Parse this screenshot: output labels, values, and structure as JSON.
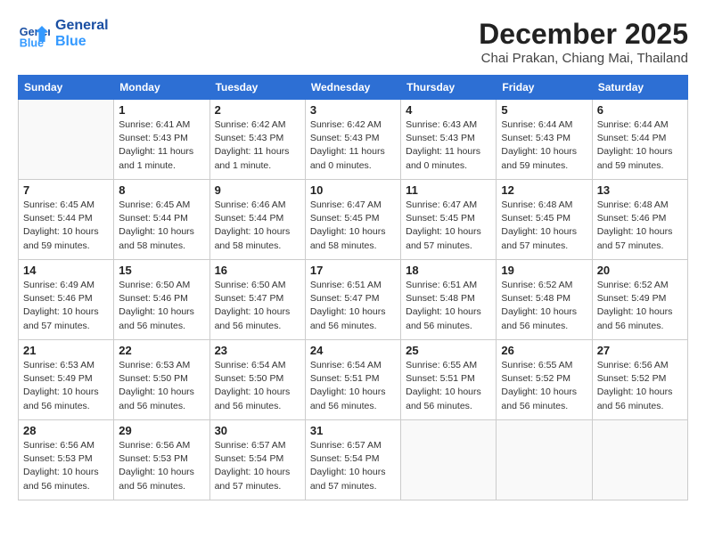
{
  "header": {
    "logo_line1": "General",
    "logo_line2": "Blue",
    "month": "December 2025",
    "location": "Chai Prakan, Chiang Mai, Thailand"
  },
  "weekdays": [
    "Sunday",
    "Monday",
    "Tuesday",
    "Wednesday",
    "Thursday",
    "Friday",
    "Saturday"
  ],
  "weeks": [
    [
      {
        "day": "",
        "info": ""
      },
      {
        "day": "1",
        "info": "Sunrise: 6:41 AM\nSunset: 5:43 PM\nDaylight: 11 hours\nand 1 minute."
      },
      {
        "day": "2",
        "info": "Sunrise: 6:42 AM\nSunset: 5:43 PM\nDaylight: 11 hours\nand 1 minute."
      },
      {
        "day": "3",
        "info": "Sunrise: 6:42 AM\nSunset: 5:43 PM\nDaylight: 11 hours\nand 0 minutes."
      },
      {
        "day": "4",
        "info": "Sunrise: 6:43 AM\nSunset: 5:43 PM\nDaylight: 11 hours\nand 0 minutes."
      },
      {
        "day": "5",
        "info": "Sunrise: 6:44 AM\nSunset: 5:43 PM\nDaylight: 10 hours\nand 59 minutes."
      },
      {
        "day": "6",
        "info": "Sunrise: 6:44 AM\nSunset: 5:44 PM\nDaylight: 10 hours\nand 59 minutes."
      }
    ],
    [
      {
        "day": "7",
        "info": "Sunrise: 6:45 AM\nSunset: 5:44 PM\nDaylight: 10 hours\nand 59 minutes."
      },
      {
        "day": "8",
        "info": "Sunrise: 6:45 AM\nSunset: 5:44 PM\nDaylight: 10 hours\nand 58 minutes."
      },
      {
        "day": "9",
        "info": "Sunrise: 6:46 AM\nSunset: 5:44 PM\nDaylight: 10 hours\nand 58 minutes."
      },
      {
        "day": "10",
        "info": "Sunrise: 6:47 AM\nSunset: 5:45 PM\nDaylight: 10 hours\nand 58 minutes."
      },
      {
        "day": "11",
        "info": "Sunrise: 6:47 AM\nSunset: 5:45 PM\nDaylight: 10 hours\nand 57 minutes."
      },
      {
        "day": "12",
        "info": "Sunrise: 6:48 AM\nSunset: 5:45 PM\nDaylight: 10 hours\nand 57 minutes."
      },
      {
        "day": "13",
        "info": "Sunrise: 6:48 AM\nSunset: 5:46 PM\nDaylight: 10 hours\nand 57 minutes."
      }
    ],
    [
      {
        "day": "14",
        "info": "Sunrise: 6:49 AM\nSunset: 5:46 PM\nDaylight: 10 hours\nand 57 minutes."
      },
      {
        "day": "15",
        "info": "Sunrise: 6:50 AM\nSunset: 5:46 PM\nDaylight: 10 hours\nand 56 minutes."
      },
      {
        "day": "16",
        "info": "Sunrise: 6:50 AM\nSunset: 5:47 PM\nDaylight: 10 hours\nand 56 minutes."
      },
      {
        "day": "17",
        "info": "Sunrise: 6:51 AM\nSunset: 5:47 PM\nDaylight: 10 hours\nand 56 minutes."
      },
      {
        "day": "18",
        "info": "Sunrise: 6:51 AM\nSunset: 5:48 PM\nDaylight: 10 hours\nand 56 minutes."
      },
      {
        "day": "19",
        "info": "Sunrise: 6:52 AM\nSunset: 5:48 PM\nDaylight: 10 hours\nand 56 minutes."
      },
      {
        "day": "20",
        "info": "Sunrise: 6:52 AM\nSunset: 5:49 PM\nDaylight: 10 hours\nand 56 minutes."
      }
    ],
    [
      {
        "day": "21",
        "info": "Sunrise: 6:53 AM\nSunset: 5:49 PM\nDaylight: 10 hours\nand 56 minutes."
      },
      {
        "day": "22",
        "info": "Sunrise: 6:53 AM\nSunset: 5:50 PM\nDaylight: 10 hours\nand 56 minutes."
      },
      {
        "day": "23",
        "info": "Sunrise: 6:54 AM\nSunset: 5:50 PM\nDaylight: 10 hours\nand 56 minutes."
      },
      {
        "day": "24",
        "info": "Sunrise: 6:54 AM\nSunset: 5:51 PM\nDaylight: 10 hours\nand 56 minutes."
      },
      {
        "day": "25",
        "info": "Sunrise: 6:55 AM\nSunset: 5:51 PM\nDaylight: 10 hours\nand 56 minutes."
      },
      {
        "day": "26",
        "info": "Sunrise: 6:55 AM\nSunset: 5:52 PM\nDaylight: 10 hours\nand 56 minutes."
      },
      {
        "day": "27",
        "info": "Sunrise: 6:56 AM\nSunset: 5:52 PM\nDaylight: 10 hours\nand 56 minutes."
      }
    ],
    [
      {
        "day": "28",
        "info": "Sunrise: 6:56 AM\nSunset: 5:53 PM\nDaylight: 10 hours\nand 56 minutes."
      },
      {
        "day": "29",
        "info": "Sunrise: 6:56 AM\nSunset: 5:53 PM\nDaylight: 10 hours\nand 56 minutes."
      },
      {
        "day": "30",
        "info": "Sunrise: 6:57 AM\nSunset: 5:54 PM\nDaylight: 10 hours\nand 57 minutes."
      },
      {
        "day": "31",
        "info": "Sunrise: 6:57 AM\nSunset: 5:54 PM\nDaylight: 10 hours\nand 57 minutes."
      },
      {
        "day": "",
        "info": ""
      },
      {
        "day": "",
        "info": ""
      },
      {
        "day": "",
        "info": ""
      }
    ]
  ]
}
